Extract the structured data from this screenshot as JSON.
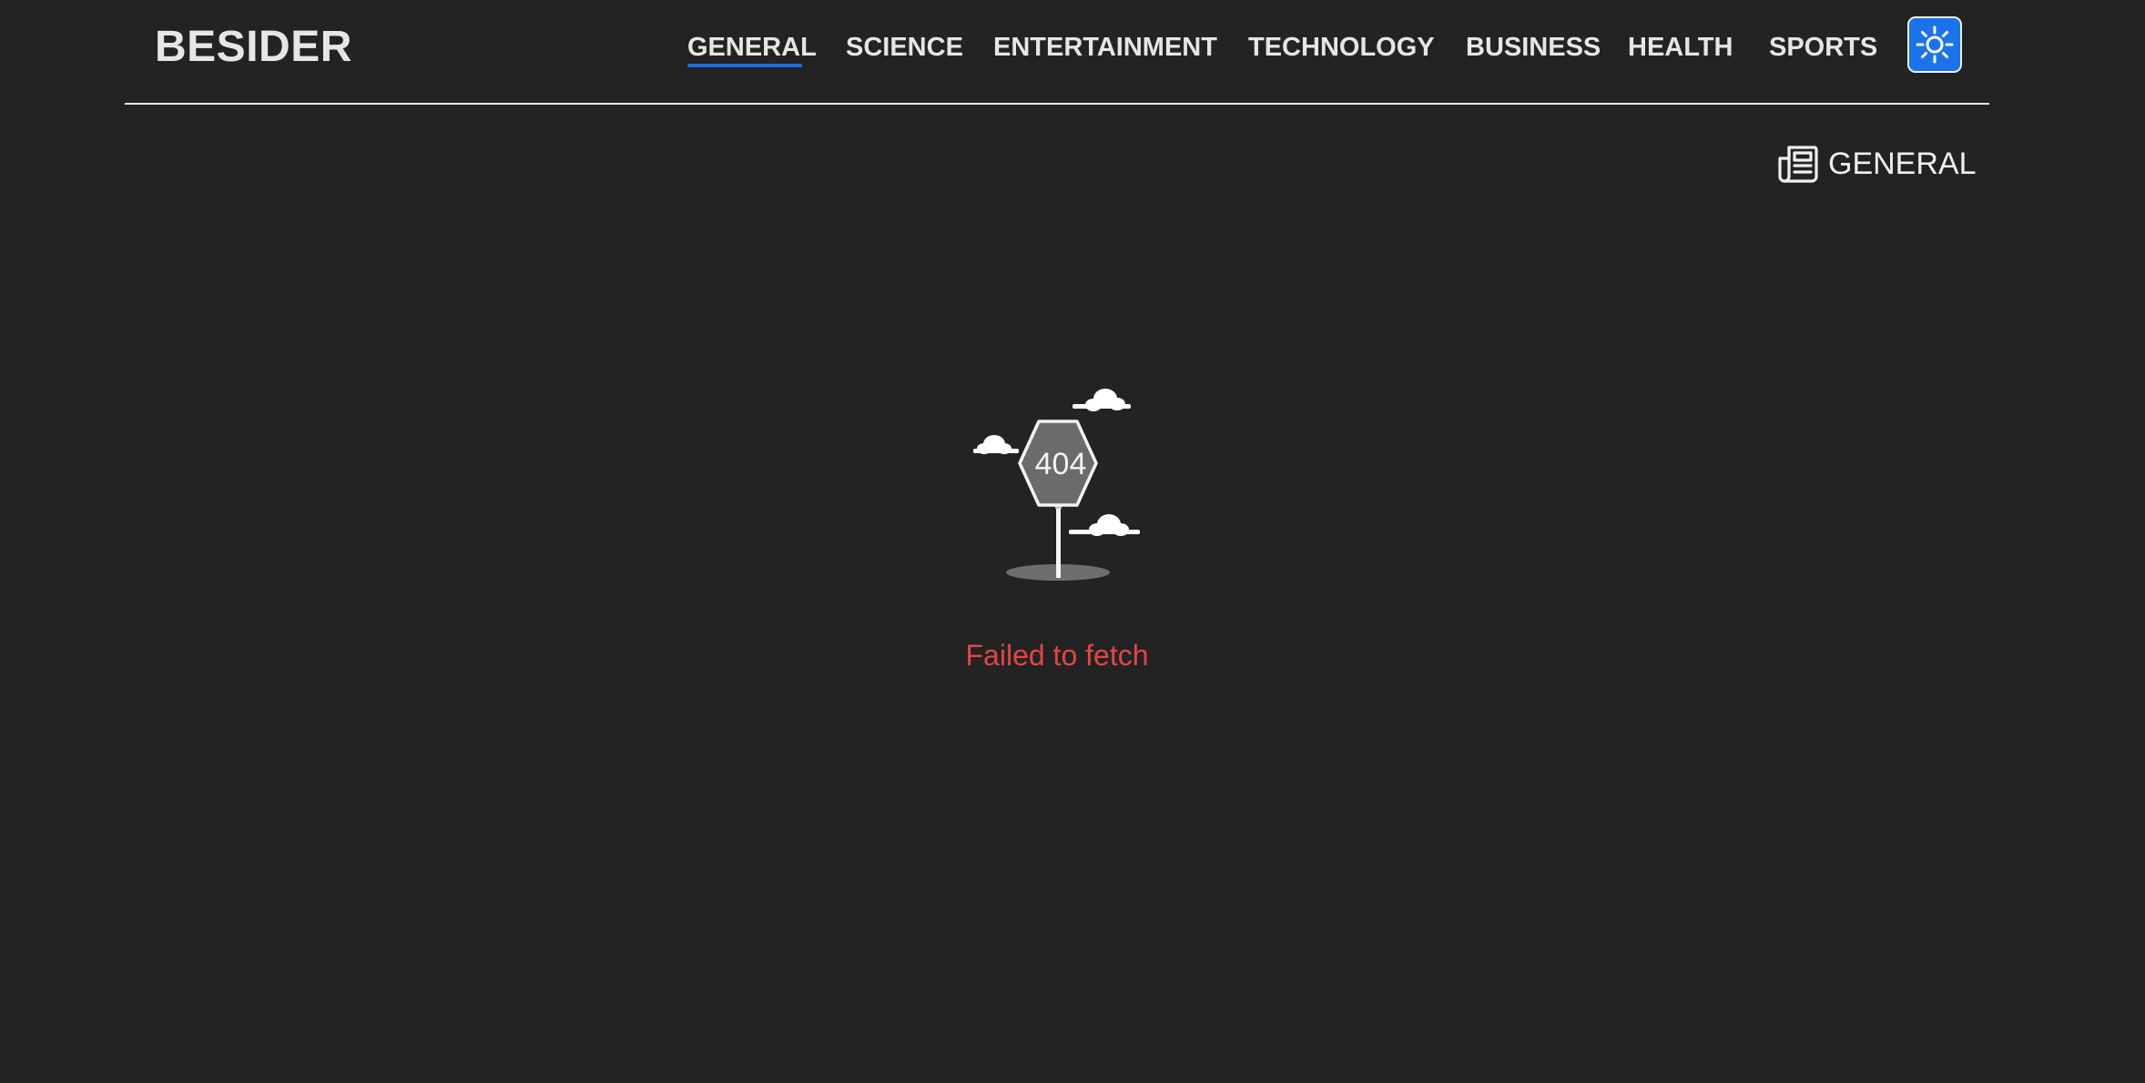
{
  "header": {
    "brand": "BESIDER",
    "nav": [
      {
        "label": "GENERAL",
        "active": true
      },
      {
        "label": "SCIENCE",
        "active": false
      },
      {
        "label": "ENTERTAINMENT",
        "active": false
      },
      {
        "label": "TECHNOLOGY",
        "active": false
      },
      {
        "label": "BUSINESS",
        "active": false
      },
      {
        "label": "HEALTH",
        "active": false
      },
      {
        "label": "SPORTS",
        "active": false
      }
    ],
    "theme_toggle_icon": "sun-icon"
  },
  "category": {
    "icon": "newspaper-icon",
    "label": "GENERAL"
  },
  "error": {
    "illustration": "404-sign-with-clouds",
    "sign_text": "404",
    "message": "Failed to fetch"
  },
  "colors": {
    "background": "#232323",
    "text": "#ececec",
    "accent": "#1a73ea",
    "active_underline": "#1e6fd9",
    "error": "#e04646",
    "sign_fill": "#6b6b6b"
  }
}
